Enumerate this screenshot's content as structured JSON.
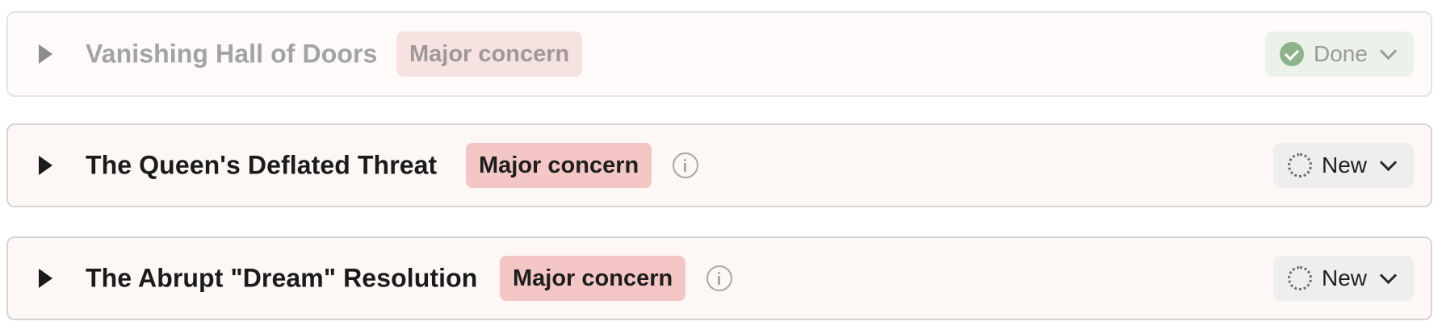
{
  "items": [
    {
      "title": "Vanishing Hall of Doors",
      "badge": "Major concern",
      "status": "Done",
      "status_icon": "check-circle-icon",
      "state": "dimmed"
    },
    {
      "title": "The Queen's Deflated Threat",
      "badge": "Major concern",
      "status": "New",
      "status_icon": "dashed-circle-icon",
      "state": "active"
    },
    {
      "title": "The Abrupt \"Dream\" Resolution",
      "badge": "Major concern",
      "status": "New",
      "status_icon": "dashed-circle-icon",
      "state": "active"
    }
  ],
  "colors": {
    "badge_bg": "#f5c6c6",
    "card_bg": "#fdf8f6",
    "done_icon": "#8eb38c"
  }
}
